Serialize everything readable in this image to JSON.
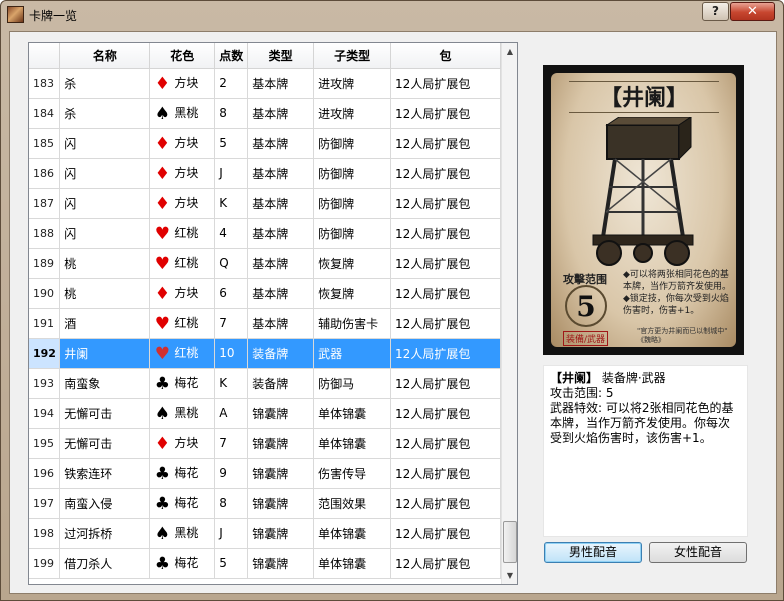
{
  "window": {
    "title": "卡牌一览",
    "help_label": "?",
    "close_label": "✕"
  },
  "table": {
    "columns": [
      "",
      "名称",
      "花色",
      "点数",
      "类型",
      "子类型",
      "包"
    ],
    "rows": [
      {
        "id": "183",
        "name": "杀",
        "suit": "方块",
        "suit_color": "red",
        "suit_icon": "diamond",
        "rank": "2",
        "type": "基本牌",
        "subtype": "进攻牌",
        "pack": "12人局扩展包"
      },
      {
        "id": "184",
        "name": "杀",
        "suit": "黑桃",
        "suit_color": "black",
        "suit_icon": "spade",
        "rank": "8",
        "type": "基本牌",
        "subtype": "进攻牌",
        "pack": "12人局扩展包"
      },
      {
        "id": "185",
        "name": "闪",
        "suit": "方块",
        "suit_color": "red",
        "suit_icon": "diamond",
        "rank": "5",
        "type": "基本牌",
        "subtype": "防御牌",
        "pack": "12人局扩展包"
      },
      {
        "id": "186",
        "name": "闪",
        "suit": "方块",
        "suit_color": "red",
        "suit_icon": "diamond",
        "rank": "J",
        "type": "基本牌",
        "subtype": "防御牌",
        "pack": "12人局扩展包"
      },
      {
        "id": "187",
        "name": "闪",
        "suit": "方块",
        "suit_color": "red",
        "suit_icon": "diamond",
        "rank": "K",
        "type": "基本牌",
        "subtype": "防御牌",
        "pack": "12人局扩展包"
      },
      {
        "id": "188",
        "name": "闪",
        "suit": "红桃",
        "suit_color": "red",
        "suit_icon": "heart",
        "rank": "4",
        "type": "基本牌",
        "subtype": "防御牌",
        "pack": "12人局扩展包"
      },
      {
        "id": "189",
        "name": "桃",
        "suit": "红桃",
        "suit_color": "red",
        "suit_icon": "heart",
        "rank": "Q",
        "type": "基本牌",
        "subtype": "恢复牌",
        "pack": "12人局扩展包"
      },
      {
        "id": "190",
        "name": "桃",
        "suit": "方块",
        "suit_color": "red",
        "suit_icon": "diamond",
        "rank": "6",
        "type": "基本牌",
        "subtype": "恢复牌",
        "pack": "12人局扩展包"
      },
      {
        "id": "191",
        "name": "酒",
        "suit": "红桃",
        "suit_color": "red",
        "suit_icon": "heart",
        "rank": "7",
        "type": "基本牌",
        "subtype": "辅助伤害卡",
        "pack": "12人局扩展包"
      },
      {
        "id": "192",
        "name": "井阑",
        "suit": "红桃",
        "suit_color": "red",
        "suit_icon": "heart",
        "rank": "10",
        "type": "装备牌",
        "subtype": "武器",
        "pack": "12人局扩展包",
        "selected": true
      },
      {
        "id": "193",
        "name": "南蛮象",
        "suit": "梅花",
        "suit_color": "black",
        "suit_icon": "club",
        "rank": "K",
        "type": "装备牌",
        "subtype": "防御马",
        "pack": "12人局扩展包"
      },
      {
        "id": "194",
        "name": "无懈可击",
        "suit": "黑桃",
        "suit_color": "black",
        "suit_icon": "spade",
        "rank": "A",
        "type": "锦囊牌",
        "subtype": "单体锦囊",
        "pack": "12人局扩展包"
      },
      {
        "id": "195",
        "name": "无懈可击",
        "suit": "方块",
        "suit_color": "red",
        "suit_icon": "diamond",
        "rank": "7",
        "type": "锦囊牌",
        "subtype": "单体锦囊",
        "pack": "12人局扩展包"
      },
      {
        "id": "196",
        "name": "铁索连环",
        "suit": "梅花",
        "suit_color": "black",
        "suit_icon": "club",
        "rank": "9",
        "type": "锦囊牌",
        "subtype": "伤害传导",
        "pack": "12人局扩展包"
      },
      {
        "id": "197",
        "name": "南蛮入侵",
        "suit": "梅花",
        "suit_color": "black",
        "suit_icon": "club",
        "rank": "8",
        "type": "锦囊牌",
        "subtype": "范围效果",
        "pack": "12人局扩展包"
      },
      {
        "id": "198",
        "name": "过河拆桥",
        "suit": "黑桃",
        "suit_color": "black",
        "suit_icon": "spade",
        "rank": "J",
        "type": "锦囊牌",
        "subtype": "单体锦囊",
        "pack": "12人局扩展包"
      },
      {
        "id": "199",
        "name": "借刀杀人",
        "suit": "梅花",
        "suit_color": "black",
        "suit_icon": "club",
        "rank": "5",
        "type": "锦囊牌",
        "subtype": "单体锦囊",
        "pack": "12人局扩展包"
      }
    ]
  },
  "card": {
    "name_banner": "【井阑】",
    "range_label": "攻擊范围",
    "range_value": "5",
    "effect_text": "◆可以将两张相同花色的基本牌，当作万箭齐发使用。◆锁定技，你每次受到火焰伤害时，伤害+1。",
    "type_stamp": "装備/武器",
    "quote": "\"官方更为井阑而已以制城中\" 《魏略》"
  },
  "description": {
    "name": "【井阑】",
    "type": "装备牌·武器",
    "line1": "攻击范围: 5",
    "line2": "武器特效: 可以将2张相同花色的基本牌，当作万箭齐发使用。你每次受到火焰伤害时，该伤害+1。"
  },
  "buttons": {
    "male_voice": "男性配音",
    "female_voice": "女性配音"
  },
  "suit_icons": {
    "diamond": "♦",
    "spade": "♠",
    "heart": "♥",
    "club": "♣"
  }
}
